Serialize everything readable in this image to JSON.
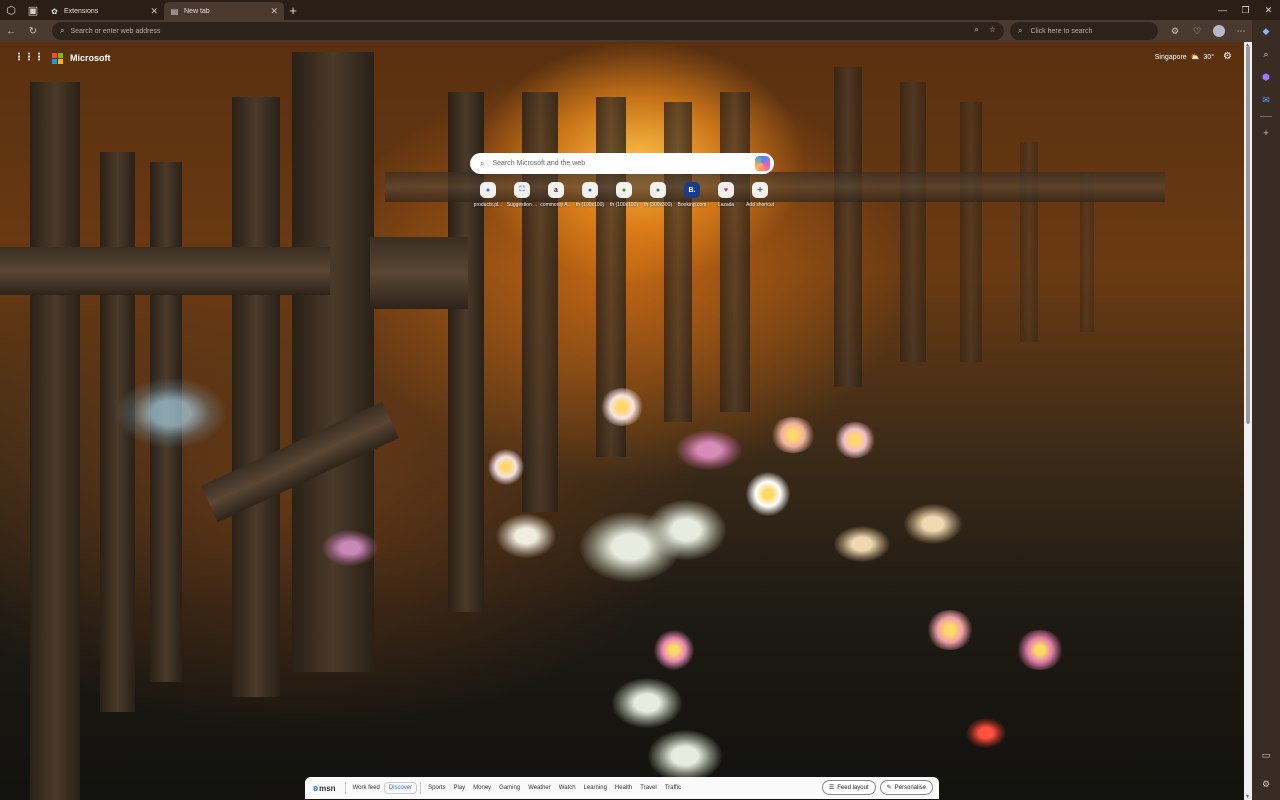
{
  "browser": {
    "tabs": [
      {
        "title": "Extensions",
        "active": false,
        "icon": "puzzle-icon"
      },
      {
        "title": "New tab",
        "active": true,
        "icon": "page-icon"
      }
    ],
    "address_placeholder": "Search or enter web address",
    "side_search_placeholder": "Click here to search"
  },
  "newtab": {
    "brand": "Microsoft",
    "weather_location": "Singapore",
    "temperature": "30°",
    "search_placeholder": "Search Microsoft and the web",
    "shortcuts": [
      {
        "label": "products.pl...",
        "glyph": "●"
      },
      {
        "label": "Suggestion ...",
        "glyph": "⛶"
      },
      {
        "label": "commonly A...",
        "glyph": "a"
      },
      {
        "label": "th (100x100)",
        "glyph": "●"
      },
      {
        "label": "th (100x100)",
        "glyph": "●"
      },
      {
        "label": "th (300x300)",
        "glyph": "●"
      },
      {
        "label": "Booking.com",
        "glyph": "B."
      },
      {
        "label": "Lazada",
        "glyph": "♥"
      },
      {
        "label": "Add shortcut",
        "glyph": "+"
      }
    ]
  },
  "msn": {
    "logo": "msn",
    "links": [
      "Work feed",
      "Discover",
      "Sports",
      "Play",
      "Money",
      "Gaming",
      "Weather",
      "Watch",
      "Learning",
      "Health",
      "Travel",
      "Traffic"
    ],
    "active_link": "Discover",
    "feed_layout": "Feed layout",
    "personalise": "Personalise"
  },
  "colors": {
    "accent": "#2a6df4",
    "chrome_dark": "#2a1e17",
    "chrome_mid": "#4a3a2f"
  }
}
